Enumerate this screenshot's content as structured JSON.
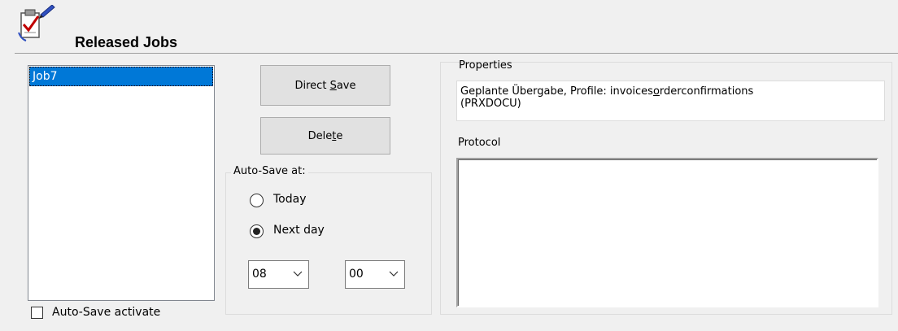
{
  "header": {
    "title": "Released Jobs",
    "icon": "clipboard-checkmark-icon"
  },
  "jobs": {
    "items": [
      {
        "label": "Job7",
        "selected": true
      }
    ]
  },
  "autosave_activate": {
    "label": "Auto-Save activate",
    "checked": false
  },
  "buttons": {
    "direct_save": {
      "pre": "Direct ",
      "accel": "S",
      "post": "ave"
    },
    "delete": {
      "pre": "Dele",
      "accel": "t",
      "post": "e"
    }
  },
  "autosave_group": {
    "title": "Auto-Save at:",
    "options": [
      {
        "label": "Today",
        "selected": false
      },
      {
        "label": "Next day",
        "selected": true
      }
    ],
    "hour": "08",
    "minute": "00"
  },
  "properties": {
    "title": "Properties",
    "text_line1": "Geplante Übergabe, Profile: invoices",
    "text_accel": "o",
    "text_line1_rest": "rderconfirmations",
    "text_line2": "(PRXDOCU)",
    "protocol_label": "Protocol",
    "protocol_text": ""
  },
  "colors": {
    "selection": "#0078d7",
    "window_bg": "#f0f0f0"
  }
}
